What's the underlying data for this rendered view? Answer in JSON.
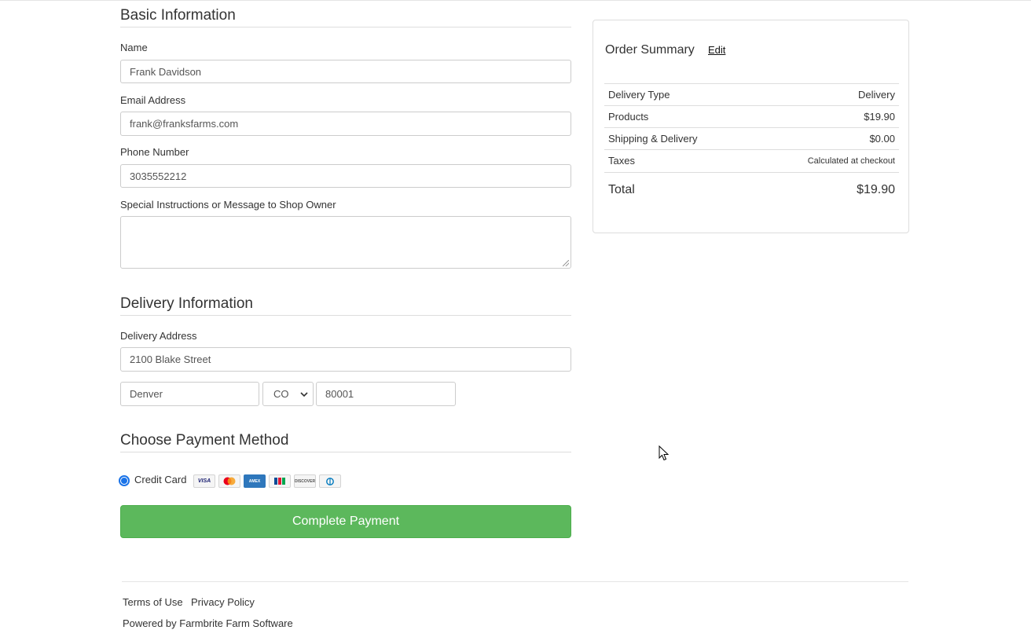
{
  "basic": {
    "title": "Basic Information",
    "name_label": "Name",
    "name_value": "Frank Davidson",
    "email_label": "Email Address",
    "email_value": "frank@franksfarms.com",
    "phone_label": "Phone Number",
    "phone_value": "3035552212",
    "instructions_label": "Special Instructions or Message to Shop Owner",
    "instructions_value": ""
  },
  "delivery": {
    "title": "Delivery Information",
    "address_label": "Delivery Address",
    "address_value": "2100 Blake Street",
    "city_value": "Denver",
    "state_value": "CO",
    "zip_value": "80001"
  },
  "payment": {
    "title": "Choose Payment Method",
    "credit_card_label": "Credit Card",
    "cards": [
      "visa",
      "mastercard",
      "amex",
      "jcb",
      "discover",
      "diners"
    ],
    "complete_button": "Complete Payment",
    "button_color": "#5cb85c"
  },
  "summary": {
    "title": "Order Summary",
    "edit_link": "Edit",
    "rows": [
      {
        "label": "Delivery Type",
        "value": "Delivery"
      },
      {
        "label": "Products",
        "value": "$19.90"
      },
      {
        "label": "Shipping & Delivery",
        "value": "$0.00"
      },
      {
        "label": "Taxes",
        "value": "Calculated at checkout"
      }
    ],
    "total_label": "Total",
    "total_value": "$19.90"
  },
  "footer": {
    "terms": "Terms of Use",
    "privacy": "Privacy Policy",
    "powered": "Powered by Farmbrite Farm Software"
  }
}
